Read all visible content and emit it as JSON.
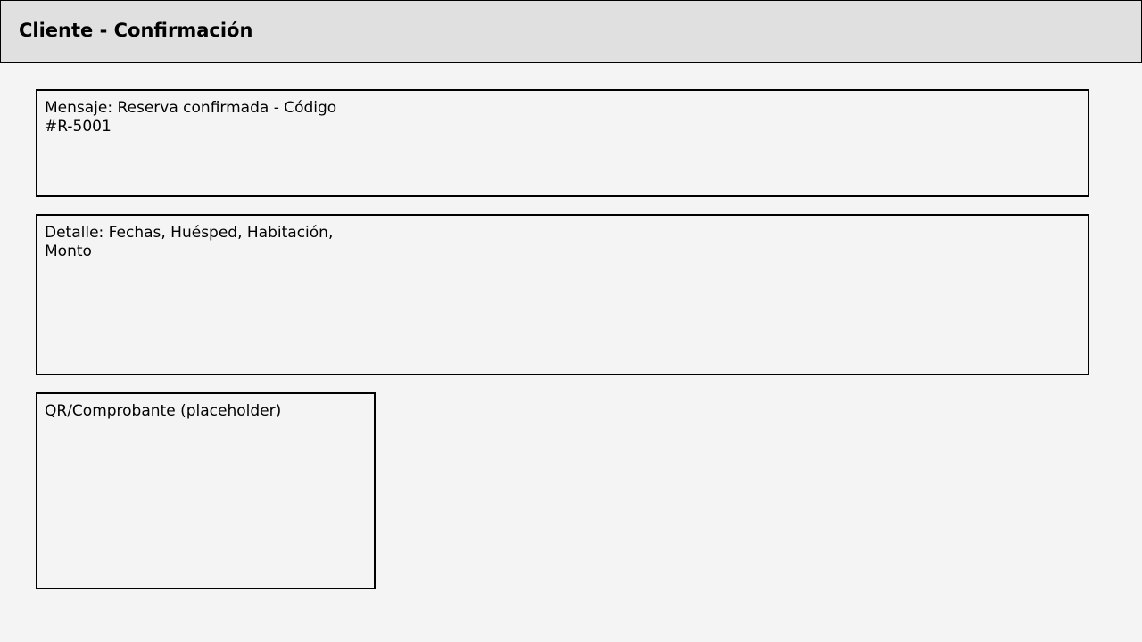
{
  "header": {
    "title": "Cliente - Confirmación"
  },
  "panels": {
    "message": "Mensaje: Reserva confirmada - Código\n#R-5001",
    "detail": "Detalle: Fechas, Huésped, Habitación,\nMonto",
    "receipt": "QR/Comprobante (placeholder)"
  }
}
